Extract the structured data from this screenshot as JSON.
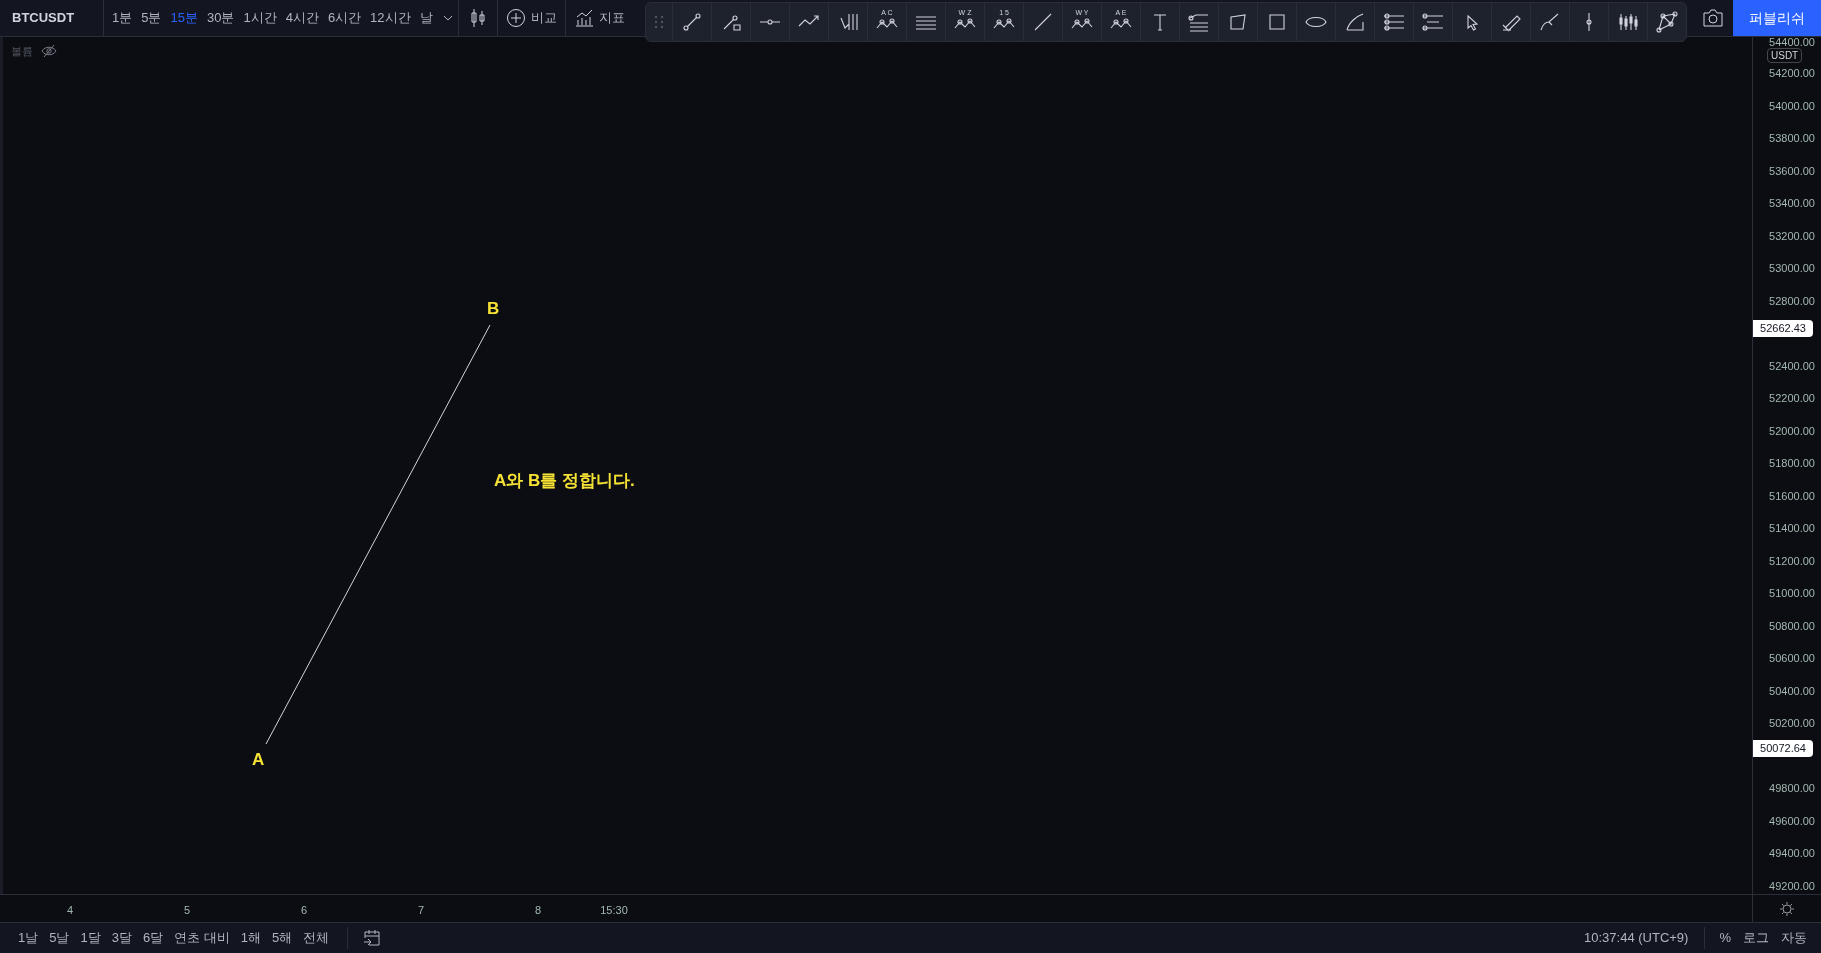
{
  "symbol": "BTCUSDT",
  "intervals": [
    {
      "label": "1분",
      "selected": false
    },
    {
      "label": "5분",
      "selected": false
    },
    {
      "label": "15분",
      "selected": true
    },
    {
      "label": "30분",
      "selected": false
    },
    {
      "label": "1시간",
      "selected": false
    },
    {
      "label": "4시간",
      "selected": false
    },
    {
      "label": "6시간",
      "selected": false
    },
    {
      "label": "12시간",
      "selected": false
    },
    {
      "label": "날",
      "selected": false
    }
  ],
  "compare_button": "비교",
  "indicators_button": "지표",
  "publish_button": "퍼블리쉬",
  "volume_legend": {
    "label": "볼륨",
    "visible": false
  },
  "drawing_tools": [
    {
      "kind": "trendline"
    },
    {
      "kind": "ray"
    },
    {
      "kind": "hline"
    },
    {
      "kind": "path"
    },
    {
      "kind": "pitchfork"
    },
    {
      "kind": "pattern",
      "letters": "A C"
    },
    {
      "kind": "channel"
    },
    {
      "kind": "pattern",
      "letters": "W Z"
    },
    {
      "kind": "pattern",
      "letters": "1 5"
    },
    {
      "kind": "line"
    },
    {
      "kind": "pattern",
      "letters": "W Y"
    },
    {
      "kind": "pattern",
      "letters": "A E"
    },
    {
      "kind": "text"
    },
    {
      "kind": "fib"
    },
    {
      "kind": "polygon"
    },
    {
      "kind": "rectangle"
    },
    {
      "kind": "ellipse"
    },
    {
      "kind": "arc"
    },
    {
      "kind": "levels"
    },
    {
      "kind": "range"
    },
    {
      "kind": "cursor"
    },
    {
      "kind": "highlighter"
    },
    {
      "kind": "brush"
    },
    {
      "kind": "vline"
    },
    {
      "kind": "candles"
    },
    {
      "kind": "network"
    }
  ],
  "chart": {
    "point_labels": [
      "A",
      "B"
    ],
    "note": "A와 B를 정합니다."
  },
  "price_axis": {
    "currency": "USDT",
    "ticks": [
      "54400.00",
      "54200.00",
      "54000.00",
      "53800.00",
      "53600.00",
      "53400.00",
      "53200.00",
      "53000.00",
      "52800.00",
      "52400.00",
      "52200.00",
      "52000.00",
      "51800.00",
      "51600.00",
      "51400.00",
      "51200.00",
      "51000.00",
      "50800.00",
      "50600.00",
      "50400.00",
      "50200.00",
      "49800.00",
      "49600.00",
      "49400.00",
      "49200.00"
    ],
    "markers": [
      "52662.43",
      "50072.64"
    ]
  },
  "time_axis": {
    "ticks": [
      "4",
      "5",
      "6",
      "7",
      "8",
      "15:30"
    ]
  },
  "ranges": [
    "1날",
    "5날",
    "1달",
    "3달",
    "6달",
    "연초 대비",
    "1해",
    "5해",
    "전체"
  ],
  "clock": "10:37:44 (UTC+9)",
  "scale_options": [
    "%",
    "로그",
    "자동"
  ]
}
